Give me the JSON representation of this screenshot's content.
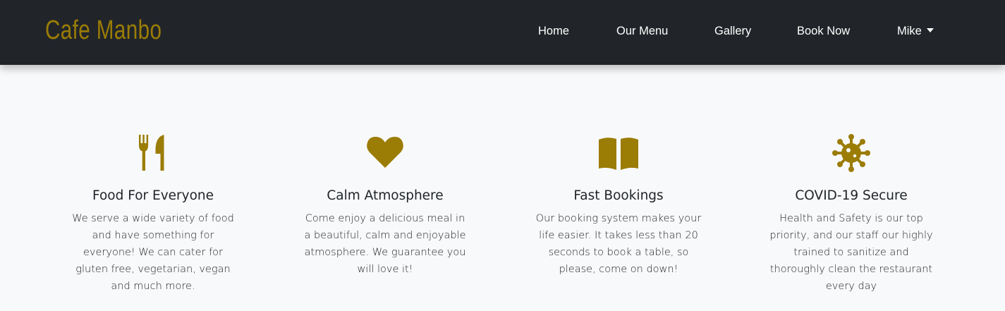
{
  "brand": {
    "name": "Cafe Manbo",
    "color": "#9b7c05"
  },
  "nav": {
    "items": [
      "Home",
      "Our Menu",
      "Gallery",
      "Book Now"
    ],
    "user": "Mike"
  },
  "features": [
    {
      "icon": "utensils-icon",
      "title": "Food For Everyone",
      "text": "We serve a wide variety of food and have something for everyone! We can cater for gluten free, vegetarian, vegan and much more."
    },
    {
      "icon": "heart-icon",
      "title": "Calm Atmosphere",
      "text": "Come enjoy a delicious meal in a beautiful, calm and enjoyable atmosphere. We guarantee you will love it!"
    },
    {
      "icon": "book-open-icon",
      "title": "Fast Bookings",
      "text": "Our booking system makes your life easier. It takes less than 20 seconds to book a table, so please, come on down!"
    },
    {
      "icon": "virus-icon",
      "title": "COVID-19 Secure",
      "text": "Health and Safety is our top priority, and our staff our highly trained to sanitize and thoroughly clean the restaurant every day"
    }
  ],
  "colors": {
    "navbar": "#212529",
    "accent": "#9b7c05",
    "background": "#f8f9fa",
    "text": "#212529"
  }
}
